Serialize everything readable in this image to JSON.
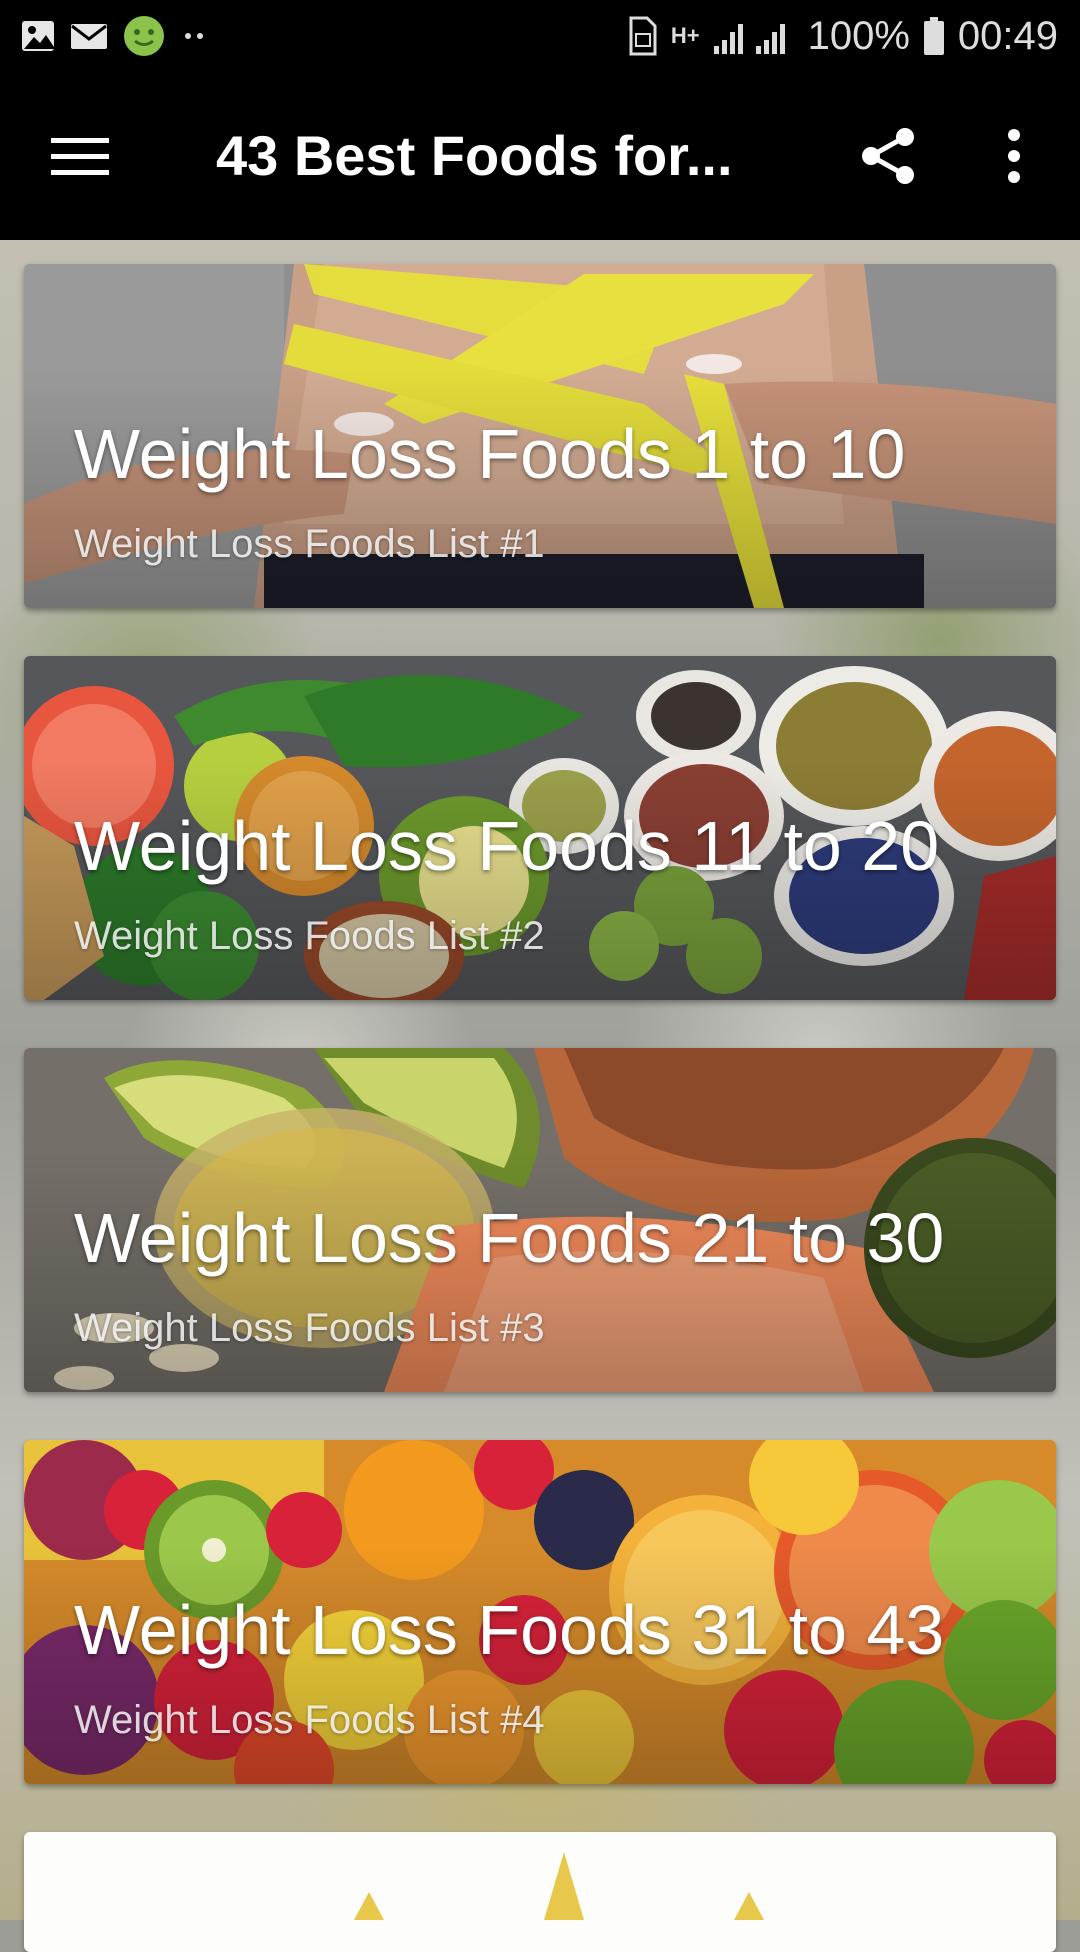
{
  "status_bar": {
    "battery": "100%",
    "time": "00:49",
    "network": "H+",
    "icons": [
      "gallery-icon",
      "email-icon",
      "smiley-icon",
      "more-notifications-icon",
      "sim-icon",
      "signal-icon",
      "battery-icon"
    ]
  },
  "app_bar": {
    "title": "43 Best Foods for...",
    "menu_icon": "hamburger-menu-icon",
    "share_icon": "share-icon",
    "more_icon": "more-vertical-icon"
  },
  "cards": [
    {
      "title": "Weight Loss Foods 1 to 10",
      "subtitle": "Weight Loss Foods List #1",
      "image": "measuring-tape-waist"
    },
    {
      "title": "Weight Loss Foods 11 to 20",
      "subtitle": "Weight Loss Foods List #2",
      "image": "vegetables-and-grains"
    },
    {
      "title": "Weight Loss Foods 21 to 30",
      "subtitle": "Weight Loss Foods List #3",
      "image": "avocado-salmon-nuts"
    },
    {
      "title": "Weight Loss Foods 31 to 43",
      "subtitle": "Weight Loss Foods List #4",
      "image": "mixed-fruits"
    }
  ],
  "colors": {
    "app_bar": "#000000",
    "title_text": "#ffffff",
    "card_title": "#ffffff"
  }
}
